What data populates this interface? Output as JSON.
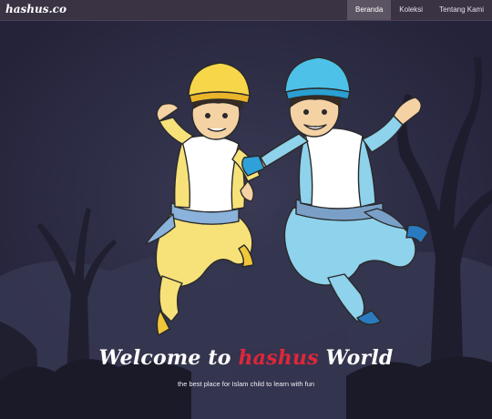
{
  "brand": {
    "name": "hashus.co"
  },
  "nav": {
    "items": [
      {
        "label": "Beranda",
        "active": true
      },
      {
        "label": "Koleksi",
        "active": false
      },
      {
        "label": "Tentang Kami",
        "active": false
      }
    ]
  },
  "hero": {
    "headline_before": "Welcome to ",
    "headline_accent": "hashus",
    "headline_after": " World",
    "tagline": "the best place for Islam child to learn with fun"
  },
  "colors": {
    "background": "#2b2a3c",
    "navbar": "#3a3344",
    "nav_active": "#5c5363",
    "accent": "#e0263a",
    "yellow_character": "#f7e27a",
    "blue_character": "#8ed2ec"
  },
  "icons": [
    "yellow-hat-boy-illustration",
    "blue-hat-boy-illustration"
  ]
}
